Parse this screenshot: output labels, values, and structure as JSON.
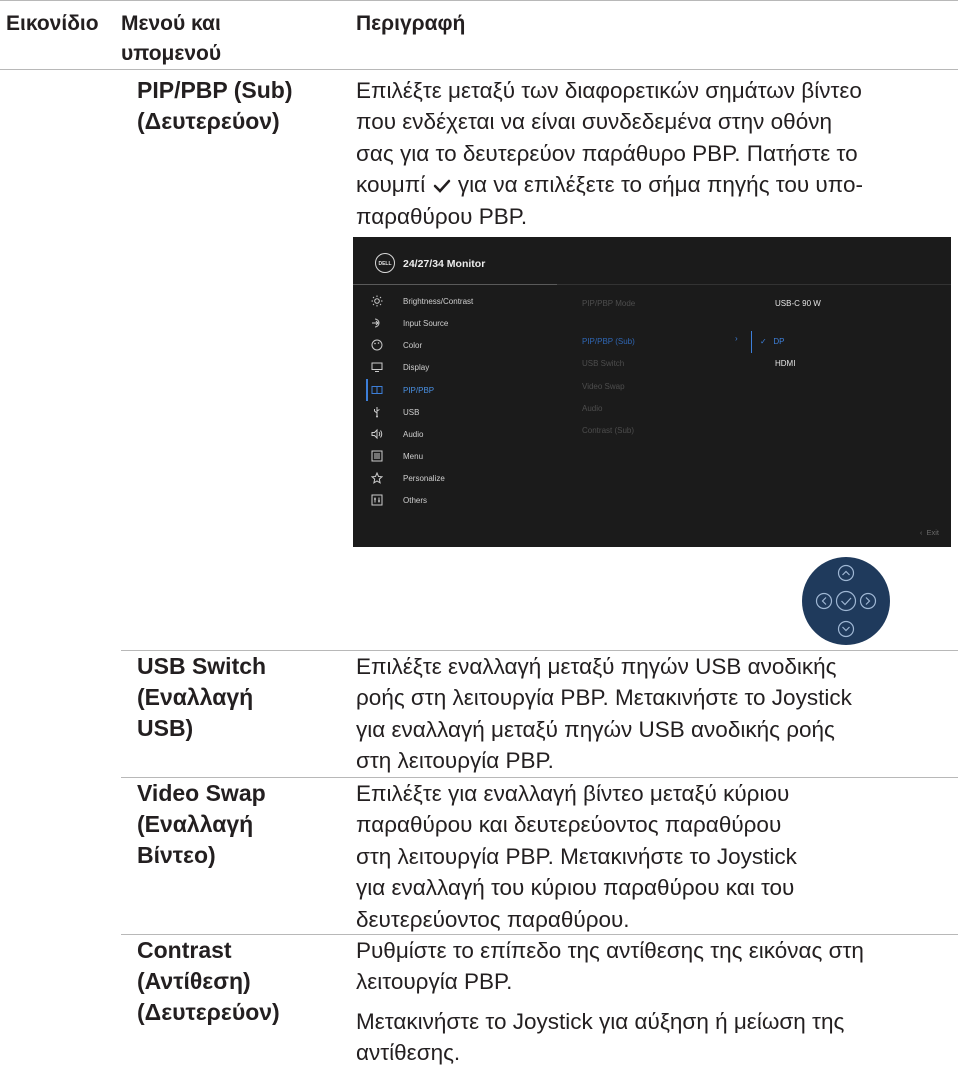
{
  "header": {
    "col1": "Εικονίδιο",
    "col2_line1": "Μενού και",
    "col2_line2": "υπομενού",
    "col3": "Περιγραφή"
  },
  "rows": [
    {
      "menu": [
        "PIP/PBP (Sub)",
        "(Δευτερεύον)"
      ],
      "desc": [
        "Επιλέξτε μεταξύ των διαφορετικών σημάτων βίντεο",
        "που ενδέχεται να είναι συνδεδεμένα στην οθόνη",
        "σας για το δευτερεύον παράθυρο PBP. Πατήστε το",
        "κουμπί",
        "για να επιλέξετε το σήμα πηγής του υπο-",
        "παραθύρου PBP."
      ]
    },
    {
      "menu": [
        "USB Switch",
        "(Εναλλαγή",
        "USB)"
      ],
      "desc": [
        "Επιλέξτε εναλλαγή μεταξύ πηγών USB ανοδικής",
        "ροής στη λειτουργία PBP. Μετακινήστε το Joystick",
        "για εναλλαγή μεταξύ πηγών USB ανοδικής ροής",
        "στη λειτουργία PBP."
      ]
    },
    {
      "menu": [
        "Video Swap",
        "(Εναλλαγή",
        "Βίντεο)"
      ],
      "desc": [
        "Επιλέξτε για εναλλαγή βίντεο μεταξύ κύριου",
        "παραθύρου και δευτερεύοντος παραθύρου",
        "στη λειτουργία PBP. Μετακινήστε το Joystick",
        "για εναλλαγή του κύριου παραθύρου και του",
        "δευτερεύοντος παραθύρου."
      ]
    },
    {
      "menu": [
        "Contrast",
        "(Αντίθεση)",
        "(Δευτερεύον)"
      ],
      "desc": [
        "Ρυθμίστε το επίπεδο της αντίθεσης της εικόνας στη",
        "λειτουργία PBP.",
        "Μετακινήστε το Joystick για αύξηση ή μείωση της",
        "αντίθεσης."
      ]
    }
  ],
  "osd": {
    "logo": "DELL",
    "title": "24/27/34 Monitor",
    "menu_items": [
      {
        "label": "Brightness/Contrast",
        "icon": "sun-icon"
      },
      {
        "label": "Input Source",
        "icon": "input-icon"
      },
      {
        "label": "Color",
        "icon": "palette-icon"
      },
      {
        "label": "Display",
        "icon": "monitor-icon"
      },
      {
        "label": "PIP/PBP",
        "icon": "pip-icon",
        "active": true
      },
      {
        "label": "USB",
        "icon": "usb-icon"
      },
      {
        "label": "Audio",
        "icon": "speaker-icon"
      },
      {
        "label": "Menu",
        "icon": "menu-icon"
      },
      {
        "label": "Personalize",
        "icon": "star-icon"
      },
      {
        "label": "Others",
        "icon": "others-icon"
      }
    ],
    "submenu": [
      "PIP/PBP Mode",
      "PIP/PBP (Sub)",
      "USB Switch",
      "Video Swap",
      "Audio",
      "Contrast (Sub)"
    ],
    "options": [
      "USB-C 90 W",
      "DP",
      "HDMI"
    ],
    "exit": "Exit"
  },
  "colors": {
    "accent": "#3d7fd9",
    "osd_bg": "#1b1b1b",
    "joystick": "#1f3a5c"
  }
}
